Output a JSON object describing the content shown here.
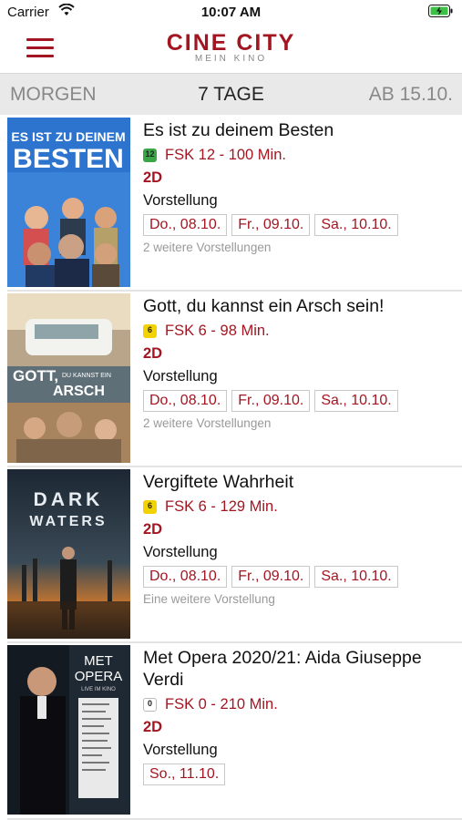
{
  "status": {
    "carrier": "Carrier",
    "time": "10:07 AM"
  },
  "header": {
    "brand": "CINE CITY",
    "tagline": "MEIN KINO"
  },
  "tabs": [
    {
      "label": "MORGEN"
    },
    {
      "label": "7 TAGE"
    },
    {
      "label": "AB 15.10."
    }
  ],
  "movies": [
    {
      "title": "Es ist zu deinem Besten",
      "fsk": "FSK 12 - 100 Min.",
      "fsk_badge": "12",
      "fsk_color": "#3aa648",
      "format": "2D",
      "label": "Vorstellung",
      "dates": [
        "Do., 08.10.",
        "Fr., 09.10.",
        "Sa., 10.10."
      ],
      "more": "2 weitere Vorstellungen",
      "poster_title": "ES IST ZU DEINEM BESTEN"
    },
    {
      "title": "Gott, du kannst ein Arsch sein!",
      "fsk": "FSK 6 - 98 Min.",
      "fsk_badge": "6",
      "fsk_color": "#f2d200",
      "format": "2D",
      "label": "Vorstellung",
      "dates": [
        "Do., 08.10.",
        "Fr., 09.10.",
        "Sa., 10.10."
      ],
      "more": "2 weitere Vorstellungen",
      "poster_title": "GOTT, DU KANNST EIN ARSCH SEIN!"
    },
    {
      "title": "Vergiftete Wahrheit",
      "fsk": "FSK 6 - 129 Min.",
      "fsk_badge": "6",
      "fsk_color": "#f2d200",
      "format": "2D",
      "label": "Vorstellung",
      "dates": [
        "Do., 08.10.",
        "Fr., 09.10.",
        "Sa., 10.10."
      ],
      "more": "Eine weitere Vorstellung",
      "poster_title": "DARK WATERS"
    },
    {
      "title": "Met Opera 2020/21: Aida Giuseppe Verdi",
      "fsk": "FSK 0 - 210 Min.",
      "fsk_badge": "0",
      "fsk_color": "#ffffff",
      "format": "2D",
      "label": "Vorstellung",
      "dates": [
        "So., 11.10."
      ],
      "more": "",
      "poster_title": "MET OPERA LIVE IM KINO"
    }
  ]
}
